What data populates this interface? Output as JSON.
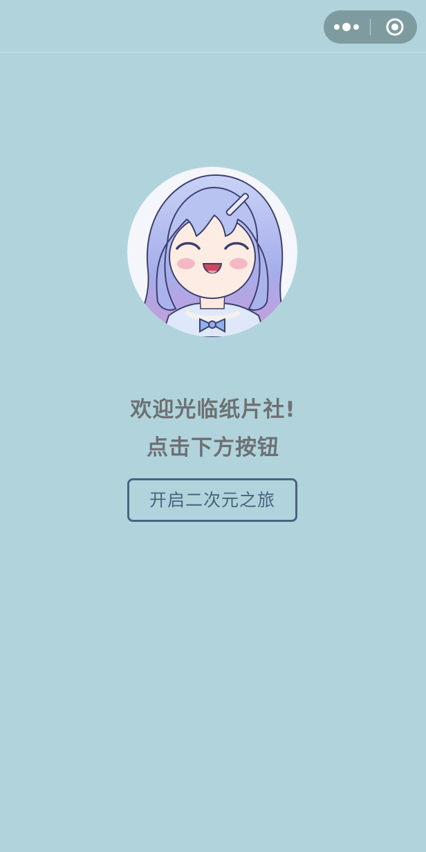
{
  "nav_bar": {
    "capsule": {
      "more_icon": "more-dots-icon",
      "close_icon": "record-circle-icon"
    }
  },
  "avatar": {
    "icon": "anime-girl-avatar",
    "colors": {
      "hair": "#a9b7ef",
      "hair_shadow": "#8790d8",
      "skin": "#fde9df",
      "blush": "#f6b7c4",
      "outfit": "#c5d7f5",
      "bow": "#8fb1ea"
    }
  },
  "main": {
    "welcome_text": "欢迎光临纸片社!",
    "hint_text": "点击下方按钮",
    "start_button_label": "开启二次元之旅"
  },
  "colors": {
    "background": "#b1d4dc",
    "text": "#6e7073",
    "button_border": "#4a6281",
    "capsule": "#7e9c9f"
  }
}
